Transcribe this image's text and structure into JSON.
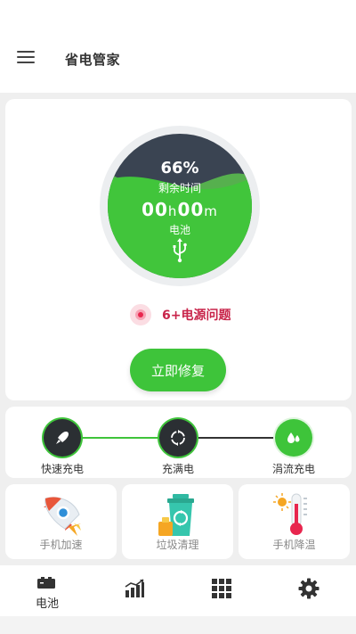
{
  "header": {
    "title": "省电管家",
    "menu_icon": "hamburger-menu-icon"
  },
  "battery": {
    "percent": "66%",
    "level": 0.66,
    "remaining_label": "剩余时间",
    "hours": "00",
    "hours_unit": "h",
    "minutes": "00",
    "minutes_unit": "m",
    "status_label": "电池",
    "status_icon": "usb-icon"
  },
  "issues": {
    "text": "6+电源问题",
    "icon": "alert-dot-icon"
  },
  "fix_button": {
    "label": "立即修复"
  },
  "charge_stages": [
    {
      "label": "快速充电",
      "icon": "rocket-icon"
    },
    {
      "label": "充满电",
      "icon": "cycle-icon"
    },
    {
      "label": "涓流充电",
      "icon": "droplets-icon"
    }
  ],
  "tools": [
    {
      "label": "手机加速",
      "icon": "rocket-icon"
    },
    {
      "label": "垃圾清理",
      "icon": "trash-bin-icon"
    },
    {
      "label": "手机降温",
      "icon": "thermometer-icon"
    }
  ],
  "bottom_nav": [
    {
      "label": "电池",
      "icon": "battery-icon"
    },
    {
      "label": "",
      "icon": "bar-chart-icon"
    },
    {
      "label": "",
      "icon": "grid-icon"
    },
    {
      "label": "",
      "icon": "gear-icon"
    }
  ],
  "colors": {
    "accent_green": "#3ec43a",
    "dark_wave": "#3a4452",
    "alert_red": "#c8244a"
  }
}
